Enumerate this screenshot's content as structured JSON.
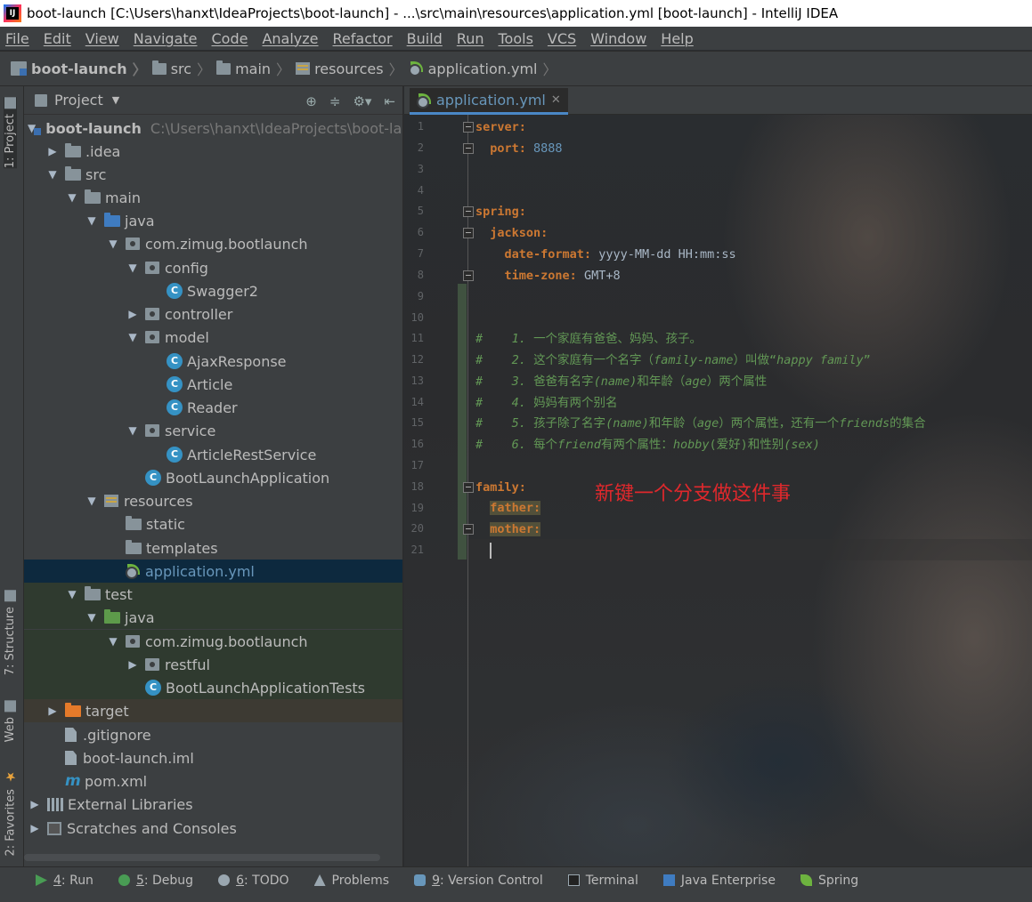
{
  "window": {
    "title": "boot-launch [C:\\Users\\hanxt\\IdeaProjects\\boot-launch] - ...\\src\\main\\resources\\application.yml [boot-launch] - IntelliJ IDEA",
    "app_icon_letters": "IJ"
  },
  "menu": [
    "File",
    "Edit",
    "View",
    "Navigate",
    "Code",
    "Analyze",
    "Refactor",
    "Build",
    "Run",
    "Tools",
    "VCS",
    "Window",
    "Help"
  ],
  "breadcrumb": [
    "boot-launch",
    "src",
    "main",
    "resources",
    "application.yml"
  ],
  "left_tabs": {
    "project": "1: Project",
    "structure": "7: Structure",
    "web": "Web",
    "favorites": "2: Favorites"
  },
  "project_panel": {
    "title": "Project",
    "tree": [
      {
        "label": "boot-launch",
        "extra": "C:\\Users\\hanxt\\IdeaProjects\\boot-launch"
      },
      {
        "label": ".idea"
      },
      {
        "label": "src"
      },
      {
        "label": "main"
      },
      {
        "label": "java"
      },
      {
        "label": "com.zimug.bootlaunch"
      },
      {
        "label": "config"
      },
      {
        "label": "Swagger2"
      },
      {
        "label": "controller"
      },
      {
        "label": "model"
      },
      {
        "label": "AjaxResponse"
      },
      {
        "label": "Article"
      },
      {
        "label": "Reader"
      },
      {
        "label": "service"
      },
      {
        "label": "ArticleRestService"
      },
      {
        "label": "BootLaunchApplication"
      },
      {
        "label": "resources"
      },
      {
        "label": "static"
      },
      {
        "label": "templates"
      },
      {
        "label": "application.yml"
      },
      {
        "label": "test"
      },
      {
        "label": "java"
      },
      {
        "label": "com.zimug.bootlaunch"
      },
      {
        "label": "restful"
      },
      {
        "label": "BootLaunchApplicationTests"
      },
      {
        "label": "target"
      },
      {
        "label": ".gitignore"
      },
      {
        "label": "boot-launch.iml"
      },
      {
        "label": "pom.xml"
      },
      {
        "label": "External Libraries"
      },
      {
        "label": "Scratches and Consoles"
      }
    ]
  },
  "editor": {
    "tab": "application.yml",
    "line_numbers": [
      "1",
      "2",
      "3",
      "4",
      "5",
      "6",
      "7",
      "8",
      "9",
      "10",
      "11",
      "12",
      "13",
      "14",
      "15",
      "16",
      "17",
      "18",
      "19",
      "20",
      "21"
    ],
    "code": {
      "l1_key": "server:",
      "l2_key": "port:",
      "l2_val": "8888",
      "l5_key": "spring:",
      "l6_key": "jackson:",
      "l7_key": "date-format:",
      "l7_val": "yyyy-MM-dd HH:mm:ss",
      "l8_key": "time-zone:",
      "l8_val": "GMT+8",
      "comments": [
        {
          "hash": "#",
          "num": "1.",
          "parts": [
            {
              "t": "一个家庭有爸爸、妈妈、孩子。",
              "s": "cn"
            }
          ]
        },
        {
          "hash": "#",
          "num": "2.",
          "parts": [
            {
              "t": "这个家庭有一个名字（",
              "s": "cn"
            },
            {
              "t": "family-name",
              "s": "it"
            },
            {
              "t": "）叫做“",
              "s": "cn"
            },
            {
              "t": "happy family",
              "s": "it"
            },
            {
              "t": "”",
              "s": "cn"
            }
          ]
        },
        {
          "hash": "#",
          "num": "3.",
          "parts": [
            {
              "t": "爸爸有名字",
              "s": "cn"
            },
            {
              "t": "(name)",
              "s": "it"
            },
            {
              "t": "和年龄（",
              "s": "cn"
            },
            {
              "t": "age",
              "s": "it"
            },
            {
              "t": "）两个属性",
              "s": "cn"
            }
          ]
        },
        {
          "hash": "#",
          "num": "4.",
          "parts": [
            {
              "t": "妈妈有两个别名",
              "s": "cn"
            }
          ]
        },
        {
          "hash": "#",
          "num": "5.",
          "parts": [
            {
              "t": "孩子除了名字",
              "s": "cn"
            },
            {
              "t": "(name)",
              "s": "it"
            },
            {
              "t": "和年龄（",
              "s": "cn"
            },
            {
              "t": "age",
              "s": "it"
            },
            {
              "t": "）两个属性，还有一个",
              "s": "cn"
            },
            {
              "t": "friends",
              "s": "it"
            },
            {
              "t": "的集合",
              "s": "cn"
            }
          ]
        },
        {
          "hash": "#",
          "num": "6.",
          "parts": [
            {
              "t": "每个",
              "s": "cn"
            },
            {
              "t": "friend",
              "s": "it"
            },
            {
              "t": "有两个属性：",
              "s": "cn"
            },
            {
              "t": "hobby",
              "s": "it"
            },
            {
              "t": "(爱好)和性别",
              "s": "cn"
            },
            {
              "t": "(sex)",
              "s": "it"
            }
          ]
        }
      ],
      "l18_key": "family:",
      "l19_key": "father:",
      "l20_key": "mother:"
    },
    "annotation": "新键一个分支做这件事"
  },
  "bottom_tools": [
    {
      "num": "4",
      "label": ": Run"
    },
    {
      "num": "5",
      "label": ": Debug"
    },
    {
      "num": "6",
      "label": ": TODO"
    },
    {
      "num": "",
      "label": "Problems"
    },
    {
      "num": "9",
      "label": ": Version Control"
    },
    {
      "num": "",
      "label": "Terminal"
    },
    {
      "num": "",
      "label": "Java Enterprise"
    },
    {
      "num": "",
      "label": "Spring"
    }
  ],
  "colors": {
    "keyword": "#cc7832",
    "number": "#6897bb",
    "comment": "#629755",
    "annotation": "#e0282c",
    "selection": "#0d293e"
  }
}
